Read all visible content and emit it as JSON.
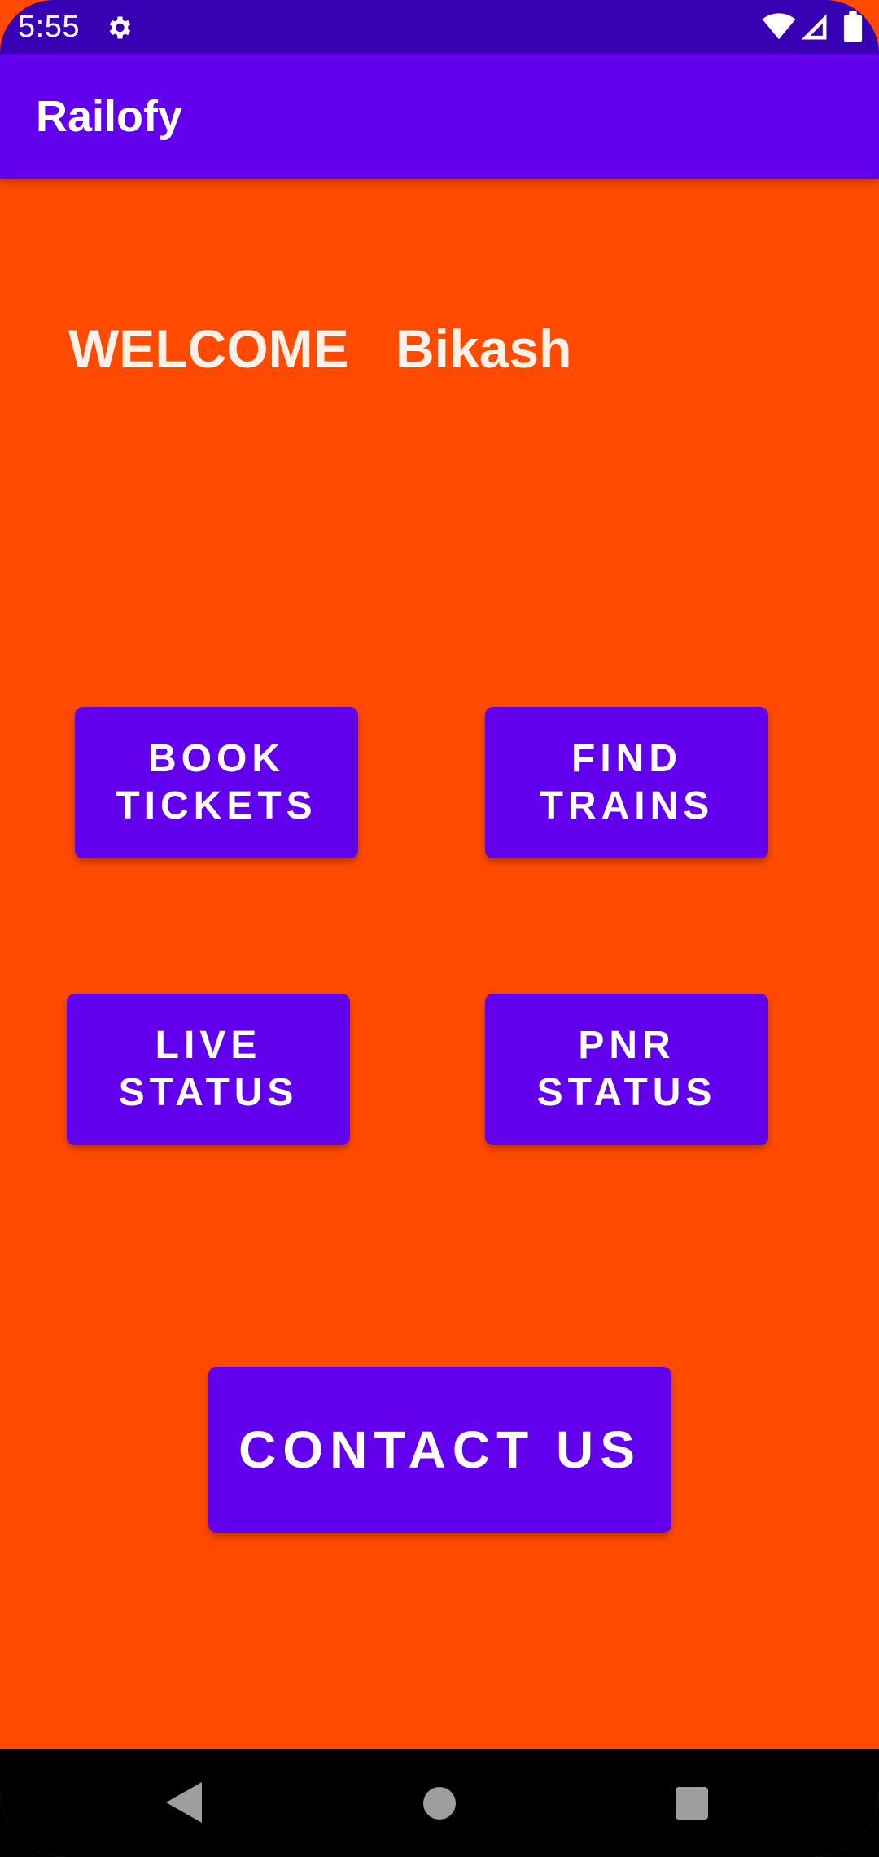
{
  "status_bar": {
    "time": "5:55",
    "icons": [
      "gear-icon",
      "wifi-icon",
      "signal-icon",
      "battery-icon"
    ]
  },
  "app_bar": {
    "title": "Railofy"
  },
  "welcome": {
    "label": "WELCOME",
    "user_name": "Bikash"
  },
  "buttons": {
    "book_tickets": {
      "line1": "BOOK",
      "line2": "TICKETS"
    },
    "find_trains": {
      "line1": "FIND",
      "line2": "TRAINS"
    },
    "live_status": {
      "line1": "LIVE",
      "line2": "STATUS"
    },
    "pnr_status": {
      "line1": "PNR",
      "line2": "STATUS"
    },
    "contact_us": "CONTACT US"
  },
  "nav_bar": {
    "icons": [
      "back-icon",
      "home-icon",
      "recents-icon"
    ]
  },
  "colors": {
    "background": "#ff4a00",
    "primary": "#6200ee",
    "status_bar": "#3700b3",
    "welcome_text": "#fff1e8"
  }
}
